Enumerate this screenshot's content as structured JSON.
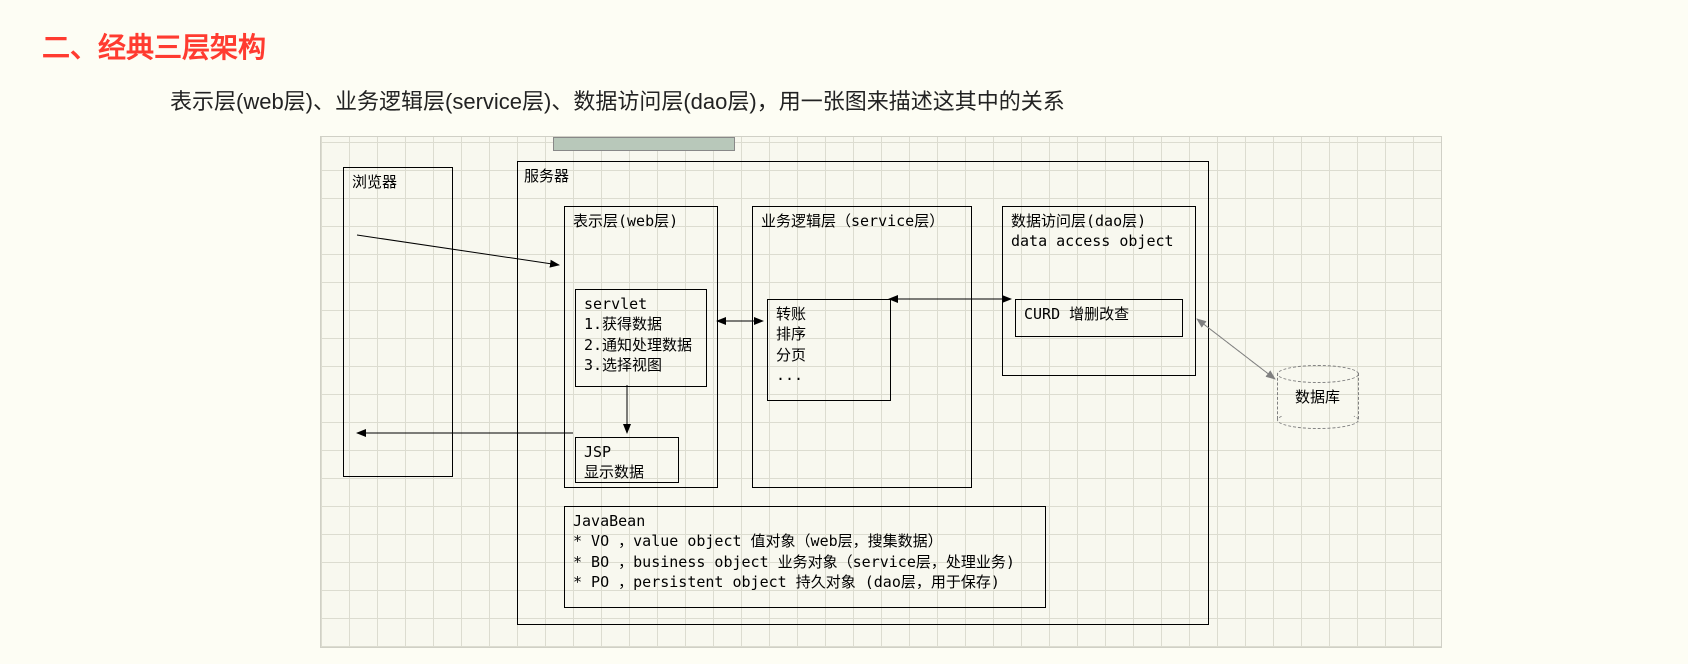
{
  "heading": "二、经典三层架构",
  "subheading": "表示层(web层)、业务逻辑层(service层)、数据访问层(dao层)，用一张图来描述这其中的关系",
  "browser": {
    "label": "浏览器"
  },
  "server": {
    "label": "服务器"
  },
  "web_layer": {
    "title": "表示层(web层)",
    "servlet": "servlet\n1.获得数据\n2.通知处理数据\n3.选择视图",
    "jsp": "JSP\n显示数据"
  },
  "service_layer": {
    "title": "业务逻辑层（service层）",
    "body": "转账\n排序\n分页\n..."
  },
  "dao_layer": {
    "title": "数据访问层(dao层)\ndata access object",
    "body": "CURD 增删改查"
  },
  "javabean": "JavaBean\n* VO ，value object 值对象（web层，搜集数据）\n* BO ，business object 业务对象（service层，处理业务)\n* PO ，persistent object 持久对象 (dao层，用于保存)",
  "database": {
    "label": "数据库"
  }
}
